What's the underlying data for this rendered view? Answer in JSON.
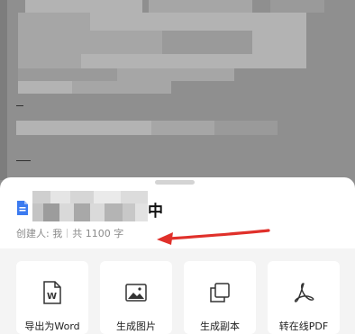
{
  "document": {
    "title_suffix": "中",
    "creator_label": "创建人: 我",
    "word_count": "共 1100 字",
    "icon": "doc-icon"
  },
  "actions": [
    {
      "label": "导出为Word",
      "icon": "word-icon"
    },
    {
      "label": "生成图片",
      "icon": "image-icon"
    },
    {
      "label": "生成副本",
      "icon": "copy-icon"
    },
    {
      "label": "转在线PDF",
      "icon": "pdf-icon"
    }
  ],
  "colors": {
    "accent_blue": "#3c7bf0",
    "arrow_red": "#e0302a",
    "overlay_gray": "#8e8e8e"
  }
}
